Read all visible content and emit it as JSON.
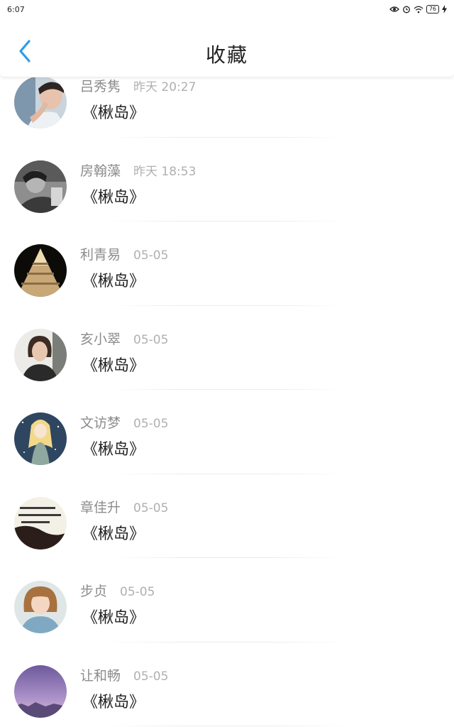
{
  "status_bar": {
    "time": "6:07",
    "battery": "76"
  },
  "header": {
    "title": "收藏",
    "back_icon": "chevron-left-icon"
  },
  "colors": {
    "accent": "#2a9ee6",
    "title": "#222222",
    "name": "#8c8c8c",
    "time": "#b0b0b0"
  },
  "items": [
    {
      "name": "吕秀隽",
      "time": "昨天 20:27",
      "content": "《楸岛》"
    },
    {
      "name": "房翰藻",
      "time": "昨天 18:53",
      "content": "《楸岛》"
    },
    {
      "name": "利青易",
      "time": "05-05",
      "content": "《楸岛》"
    },
    {
      "name": "亥小翠",
      "time": "05-05",
      "content": "《楸岛》"
    },
    {
      "name": "文访梦",
      "time": "05-05",
      "content": "《楸岛》"
    },
    {
      "name": "章佳升",
      "time": "05-05",
      "content": "《楸岛》"
    },
    {
      "name": "步贞",
      "time": "05-05",
      "content": "《楸岛》"
    },
    {
      "name": "让和畅",
      "time": "05-05",
      "content": "《楸岛》"
    }
  ]
}
